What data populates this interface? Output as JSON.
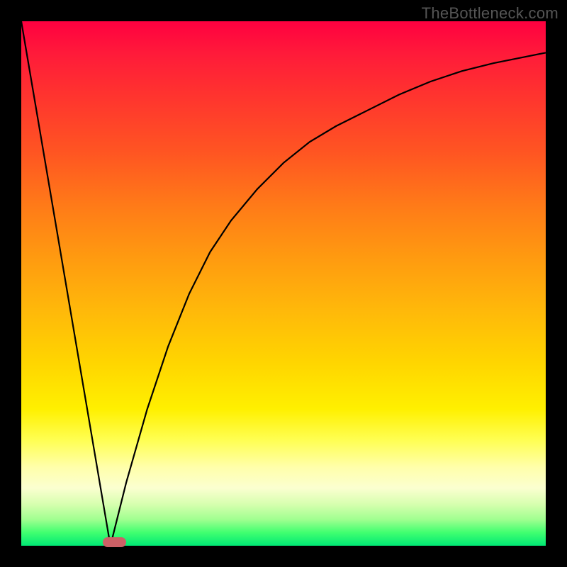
{
  "watermark": "TheBottleneck.com",
  "colors": {
    "frame_border": "#000000",
    "curve": "#000000",
    "marker": "#cc6066"
  },
  "chart_data": {
    "type": "line",
    "title": "",
    "xlabel": "",
    "ylabel": "",
    "xlim": [
      0,
      100
    ],
    "ylim": [
      0,
      100
    ],
    "grid": false,
    "legend": false,
    "series": [
      {
        "name": "left-descent",
        "x": [
          0,
          17
        ],
        "y": [
          100,
          0
        ]
      },
      {
        "name": "right-ascent",
        "x": [
          17,
          20,
          24,
          28,
          32,
          36,
          40,
          45,
          50,
          55,
          60,
          66,
          72,
          78,
          84,
          90,
          96,
          100
        ],
        "y": [
          0,
          12,
          26,
          38,
          48,
          56,
          62,
          68,
          73,
          77,
          80,
          83,
          86,
          88.5,
          90.5,
          92,
          93.2,
          94
        ]
      }
    ],
    "marker": {
      "x_range": [
        15.5,
        20
      ],
      "y": 0,
      "description": "optimal-range-indicator"
    }
  }
}
